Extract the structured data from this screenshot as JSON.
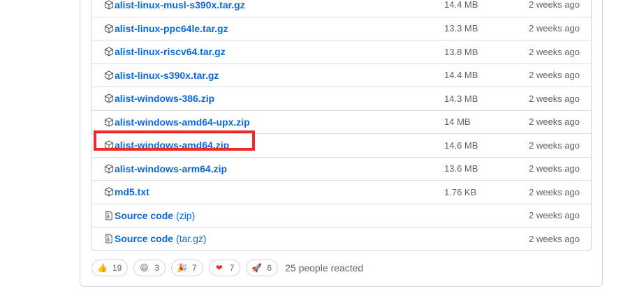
{
  "assets": [
    {
      "name": "alist-linux-musl-s390x.tar.gz",
      "suffix": "",
      "size": "14.4 MB",
      "time": "2 weeks ago",
      "icon": "package-icon"
    },
    {
      "name": "alist-linux-ppc64le.tar.gz",
      "suffix": "",
      "size": "13.3 MB",
      "time": "2 weeks ago",
      "icon": "package-icon"
    },
    {
      "name": "alist-linux-riscv64.tar.gz",
      "suffix": "",
      "size": "13.8 MB",
      "time": "2 weeks ago",
      "icon": "package-icon"
    },
    {
      "name": "alist-linux-s390x.tar.gz",
      "suffix": "",
      "size": "14.4 MB",
      "time": "2 weeks ago",
      "icon": "package-icon"
    },
    {
      "name": "alist-windows-386.zip",
      "suffix": "",
      "size": "14.3 MB",
      "time": "2 weeks ago",
      "icon": "package-icon"
    },
    {
      "name": "alist-windows-amd64-upx.zip",
      "suffix": "",
      "size": "14 MB",
      "time": "2 weeks ago",
      "icon": "package-icon"
    },
    {
      "name": "alist-windows-amd64.zip",
      "suffix": "",
      "size": "14.6 MB",
      "time": "2 weeks ago",
      "icon": "package-icon"
    },
    {
      "name": "alist-windows-arm64.zip",
      "suffix": "",
      "size": "13.6 MB",
      "time": "2 weeks ago",
      "icon": "package-icon"
    },
    {
      "name": "md5.txt",
      "suffix": "",
      "size": "1.76 KB",
      "time": "2 weeks ago",
      "icon": "package-icon"
    },
    {
      "name": "Source code",
      "suffix": "(zip)",
      "size": "",
      "time": "2 weeks ago",
      "icon": "file-zip-icon"
    },
    {
      "name": "Source code",
      "suffix": "(tar.gz)",
      "size": "",
      "time": "2 weeks ago",
      "icon": "file-zip-icon"
    }
  ],
  "reactions": [
    {
      "emoji": "👍",
      "count": "19",
      "name": "thumbs-up"
    },
    {
      "emoji": "😄",
      "count": "3",
      "name": "laugh"
    },
    {
      "emoji": "🎉",
      "count": "7",
      "name": "hooray"
    },
    {
      "emoji": "❤",
      "count": "7",
      "name": "heart"
    },
    {
      "emoji": "🚀",
      "count": "6",
      "name": "rocket"
    }
  ],
  "reaction_summary": "25 people reacted",
  "colors": {
    "link": "#0969da",
    "muted": "#59636e",
    "border": "#d0d7de",
    "highlight": "#ee2a2a"
  }
}
